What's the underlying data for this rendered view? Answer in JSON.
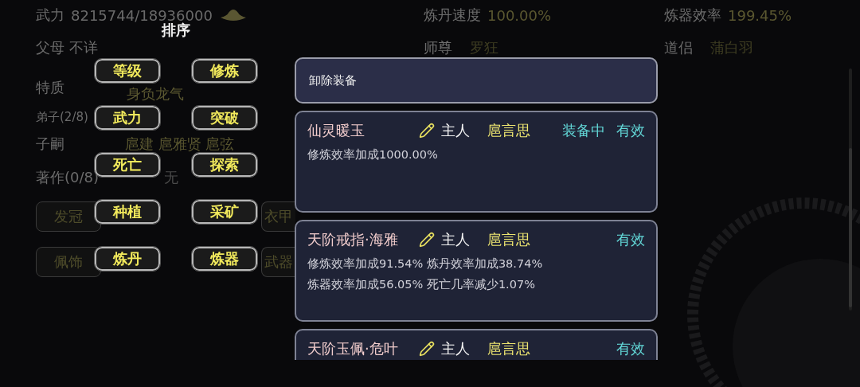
{
  "stats": [
    {
      "label": "武力",
      "value": "8215744/18936000"
    },
    {
      "label": "炼丹速度",
      "value": "100.00%"
    },
    {
      "label": "炼器效率",
      "value": "199.45%"
    }
  ],
  "relations": [
    {
      "label": "父母",
      "value": "不详"
    },
    {
      "label": "师尊",
      "value": "罗狂"
    },
    {
      "label": "道侣",
      "value": "蒲白羽"
    }
  ],
  "traits": {
    "label": "特质",
    "value": "身负龙气"
  },
  "disciples": {
    "label": "弟子(2/8)"
  },
  "heirs": {
    "label": "子嗣",
    "value": "扈建 扈雅贤 扈弦"
  },
  "works": {
    "label": "著作(0/8)",
    "value": "无"
  },
  "slots": [
    {
      "label": "发冠"
    },
    {
      "label": "衣甲"
    },
    {
      "label": "佩饰"
    },
    {
      "label": "武器"
    }
  ],
  "sort": {
    "title": "排序",
    "options": [
      {
        "label": "等级"
      },
      {
        "label": "修炼"
      },
      {
        "label": "武力"
      },
      {
        "label": "突破"
      },
      {
        "label": "死亡"
      },
      {
        "label": "探索"
      },
      {
        "label": "种植"
      },
      {
        "label": "采矿"
      },
      {
        "label": "炼丹"
      },
      {
        "label": "炼器"
      }
    ]
  },
  "dialog": {
    "header": "卸除装备",
    "items": [
      {
        "name": "仙灵暖玉",
        "owner_label": "主人",
        "owner": "扈言思",
        "badge": "装备中",
        "status": "有效",
        "effects": [
          "修炼效率加成1000.00%"
        ]
      },
      {
        "name": "天阶戒指·海雅",
        "owner_label": "主人",
        "owner": "扈言思",
        "status": "有效",
        "effects": [
          "修炼效率加成91.54% 炼丹效率加成38.74%",
          "炼器效率加成56.05% 死亡几率减少1.07%"
        ]
      },
      {
        "name": "天阶玉佩·危叶",
        "owner_label": "主人",
        "owner": "扈言思",
        "status": "有效"
      }
    ]
  }
}
